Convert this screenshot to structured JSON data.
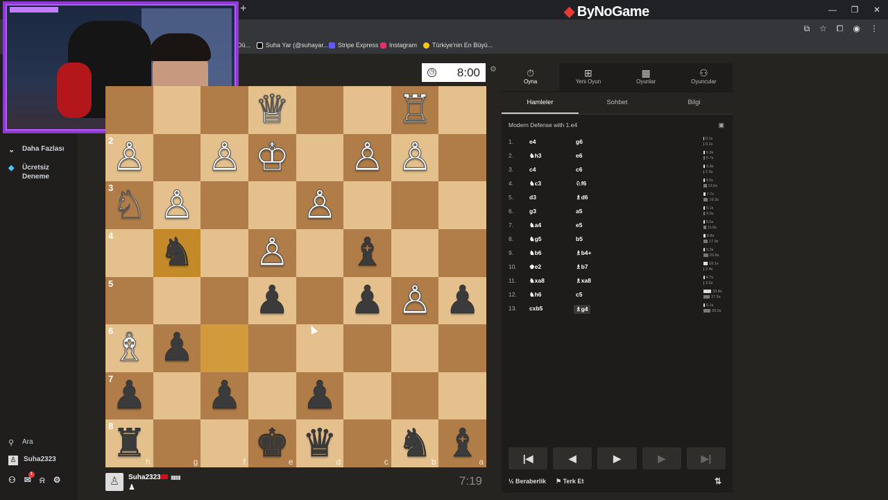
{
  "window": {
    "title": "ByNoGame",
    "new_tab": "+",
    "controls": [
      "—",
      "❐",
      "✕"
    ]
  },
  "browser": {
    "icons": [
      "install-icon",
      "star-icon",
      "extensions-icon",
      "profile-icon",
      "menu-icon"
    ],
    "bookmarks": [
      {
        "label": "Dü...",
        "color": "#555"
      },
      {
        "label": "Suha Yar (@suhayar....",
        "color": "#000"
      },
      {
        "label": "Stripe Express",
        "color": "#635bff"
      },
      {
        "label": "Instagram",
        "color": "#e1306c"
      },
      {
        "label": "Türkiye'nin En Büyü...",
        "color": "#f5c518"
      }
    ]
  },
  "sidebar": {
    "items": [
      {
        "label": "Daha Fazlası",
        "icon": "more-icon"
      },
      {
        "label": "Ücretsiz Deneme",
        "icon": "diamond-icon"
      }
    ],
    "bottom": {
      "search_label": "Ara",
      "username": "Suha2323",
      "notif_count": "1",
      "icons": [
        "friends-icon",
        "mail-icon",
        "bell-icon",
        "settings-icon"
      ]
    }
  },
  "game": {
    "opponent_clock": "8:00",
    "player_clock": "7:19",
    "player_name": "Suha2323",
    "player_bars": "▮▮▮▮",
    "board": [
      [
        "",
        "",
        "",
        "",
        "♕",
        "",
        "",
        "♖"
      ],
      [
        "",
        "♙",
        "",
        "♙",
        "♔",
        "",
        "♙",
        "♙"
      ],
      [
        "",
        "♘",
        "♙",
        "",
        "",
        "♙",
        "",
        ""
      ],
      [
        "",
        "",
        "♞",
        "",
        "♙",
        "",
        "♝",
        ""
      ],
      [
        "",
        "",
        "",
        "",
        "♟",
        "",
        "♟",
        "♙",
        "♟"
      ],
      [
        "",
        "♗",
        "♟",
        "",
        "",
        "",
        "",
        ""
      ],
      [
        "",
        "♟",
        "",
        "♟",
        "",
        "♟",
        "",
        ""
      ],
      [
        "",
        "♜",
        "",
        "",
        "♚",
        "♛",
        "",
        "♞",
        "♝"
      ]
    ],
    "ranks": [
      "",
      "2",
      "3",
      "4",
      "5",
      "6",
      "7",
      "8"
    ],
    "files": [
      "h",
      "g",
      "f",
      "e",
      "d",
      "c",
      "b",
      "a"
    ]
  },
  "panel": {
    "top_tabs": [
      {
        "label": "Oyna",
        "icon": "stopwatch-icon"
      },
      {
        "label": "Yeni Oyun",
        "icon": "plus-icon"
      },
      {
        "label": "Oyunlar",
        "icon": "board-icon"
      },
      {
        "label": "Oyuncular",
        "icon": "players-icon"
      }
    ],
    "sub_tabs": [
      "Hamleler",
      "Sohbet",
      "Bilgi"
    ],
    "opening": "Modern Defense with 1.e4",
    "moves": [
      {
        "n": "1.",
        "w": "e4",
        "b": "g6",
        "tw": "0.1s",
        "tb": "0.1s"
      },
      {
        "n": "2.",
        "w": "♞h3",
        "b": "e6",
        "tw": "5.3s",
        "tb": "5.7s"
      },
      {
        "n": "3.",
        "w": "c4",
        "b": "c6",
        "tw": "6.8s",
        "tb": "2.3s"
      },
      {
        "n": "4.",
        "w": "♞c3",
        "b": "♘f6",
        "tw": "4.5s",
        "tb": "13.6s"
      },
      {
        "n": "5.",
        "w": "d3",
        "b": "♗d6",
        "tw": "7.7s",
        "tb": "19.3s"
      },
      {
        "n": "6.",
        "w": "g3",
        "b": "a5",
        "tw": "6.1s",
        "tb": "6.9s"
      },
      {
        "n": "7.",
        "w": "♞a4",
        "b": "e5",
        "tw": "5.5s",
        "tb": "11.6s"
      },
      {
        "n": "8.",
        "w": "♞g5",
        "b": "b5",
        "tw": "8.8s",
        "tb": "17.9s"
      },
      {
        "n": "9.",
        "w": "♞b6",
        "b": "♗b4+",
        "tw": "6.3s",
        "tb": "20.8s"
      },
      {
        "n": "10.",
        "w": "♚e2",
        "b": "♗b7",
        "tw": "18.1s",
        "tb": "2.4s"
      },
      {
        "n": "11.",
        "w": "♞xa8",
        "b": "♗xa8",
        "tw": "4.7s",
        "tb": "2.5s"
      },
      {
        "n": "12.",
        "w": "♞h6",
        "b": "c5",
        "tw": "33.8s",
        "tb": "27.5s"
      },
      {
        "n": "13.",
        "w": "cxb5",
        "b": "♗g4",
        "tw": "6.1s",
        "tb": "30.0s"
      }
    ],
    "nav": [
      "|◀",
      "◀",
      "▶",
      "▶",
      "▶|"
    ],
    "draw_label": "Beraberlik",
    "resign_label": "Terk Et",
    "draw_icon": "½",
    "resign_icon": "⚑",
    "flip_icon": "⇅"
  }
}
